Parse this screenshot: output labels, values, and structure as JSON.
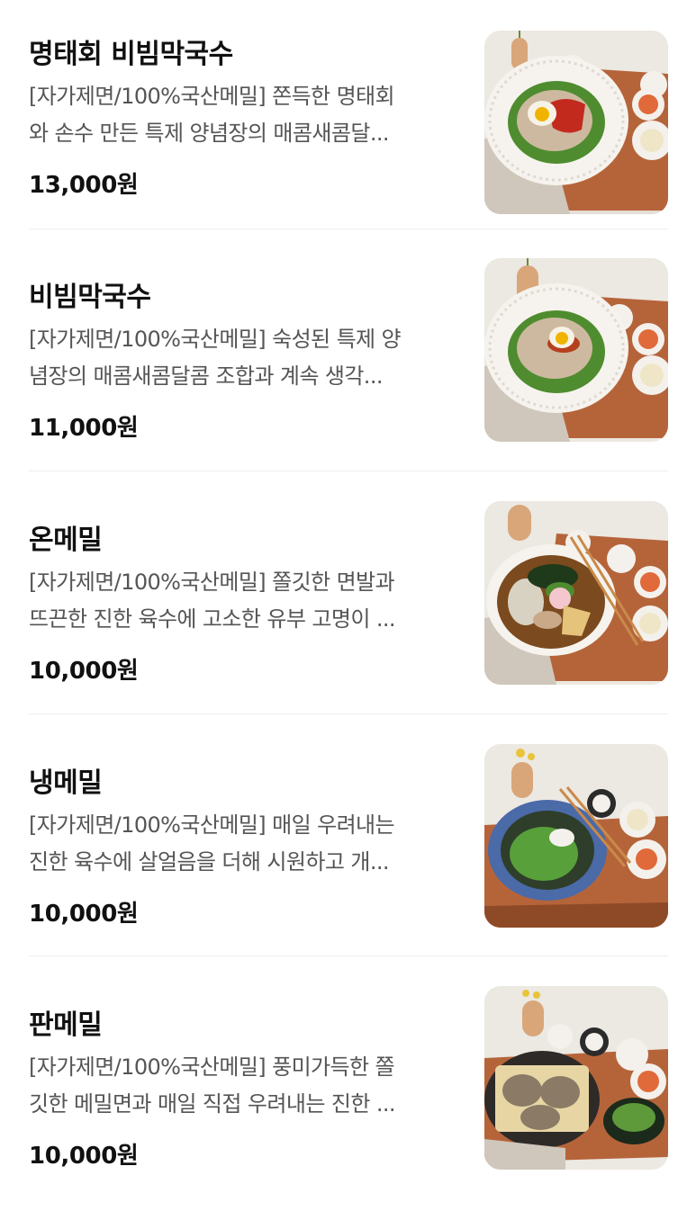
{
  "menu": {
    "items": [
      {
        "name": "명태회 비빔막국수",
        "desc_line1": "[자가제면/100%국산메밀] 쫀득한 명태회",
        "desc_line2": "와 손수 만든 특제 양념장의 매콤새콤달...",
        "price": "13,000원",
        "photo": {
          "bowl": "white-ridged",
          "topping": "red-pollock-and-egg",
          "chopsticks": false
        }
      },
      {
        "name": "비빔막국수",
        "desc_line1": "[자가제면/100%국산메밀] 숙성된 특제 양",
        "desc_line2": "념장의 매콤새콤달콤 조합과 계속 생각...",
        "price": "11,000원",
        "photo": {
          "bowl": "white-ridged",
          "topping": "egg-and-sauce",
          "chopsticks": false
        }
      },
      {
        "name": "온메밀",
        "desc_line1": "[자가제면/100%국산메밀] 쫄깃한 면발과",
        "desc_line2": "뜨끈한 진한 육수에 고소한 유부 고명이 ...",
        "price": "10,000원",
        "photo": {
          "bowl": "white-ridged",
          "topping": "fishcake-and-tofu-skin",
          "chopsticks": true
        }
      },
      {
        "name": "냉메밀",
        "desc_line1": "[자가제면/100%국산메밀] 매일 우려내는",
        "desc_line2": "진한 육수에 살얼음을 더해 시원하고 개...",
        "price": "10,000원",
        "photo": {
          "bowl": "blue-scalloped",
          "topping": "scallion-and-seaweed",
          "chopsticks": true
        }
      },
      {
        "name": "판메밀",
        "desc_line1": "[자가제면/100%국산메밀] 풍미가득한 쫄",
        "desc_line2": "깃한 메밀면과 매일 직접 우려내는 진한 ...",
        "price": "10,000원",
        "photo": {
          "bowl": "dark-plate-bamboo-mat",
          "topping": "noodle-bundles",
          "chopsticks": false
        }
      }
    ]
  },
  "colors": {
    "text_primary": "#111111",
    "text_secondary": "#555555",
    "divider": "#eeeeee",
    "tray_wood": "#b5643a"
  }
}
